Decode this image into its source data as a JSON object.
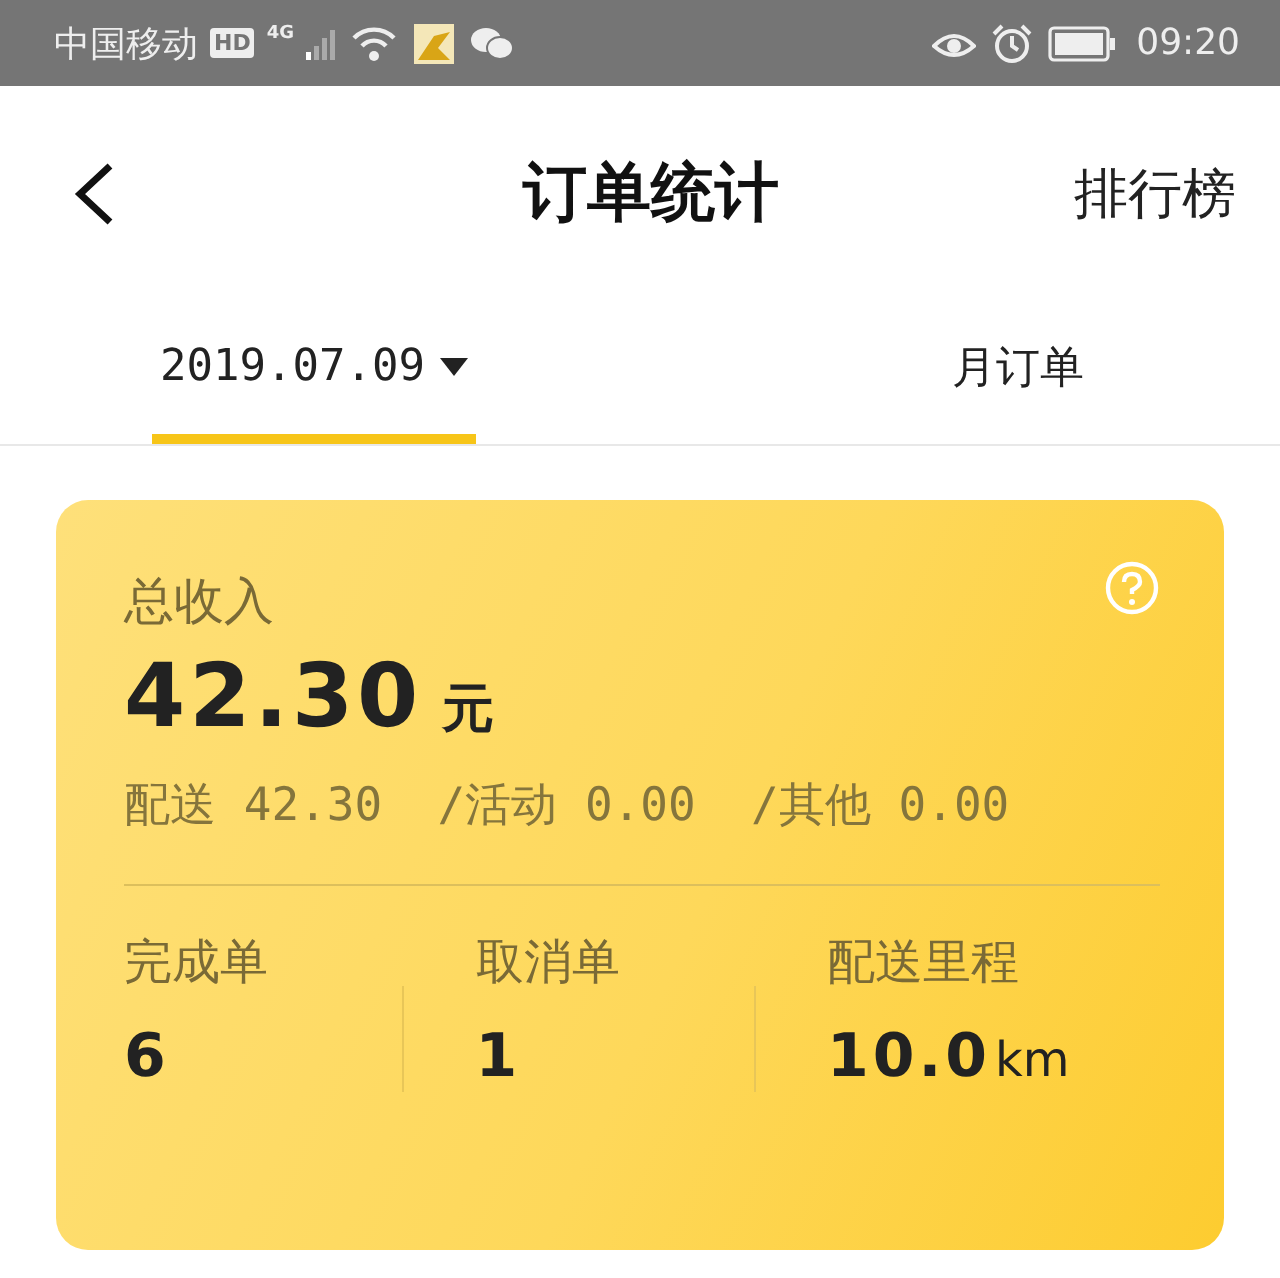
{
  "status_bar": {
    "carrier": "中国移动",
    "hd_badge": "HD",
    "network": "4G",
    "time": "09:20"
  },
  "header": {
    "title": "订单统计",
    "action": "排行榜"
  },
  "tabs": [
    {
      "label": "2019.07.09",
      "kind": "dropdown",
      "selected": true
    },
    {
      "label": "月订单",
      "kind": "plain",
      "selected": false
    }
  ],
  "summary": {
    "label": "总收入",
    "amount": "42.30",
    "currency": "元",
    "breakdown": "配送 42.30  /活动 0.00  /其他 0.00",
    "stats": [
      {
        "label": "完成单",
        "value": "6"
      },
      {
        "label": "取消单",
        "value": "1"
      },
      {
        "label": "配送里程",
        "value": "10.0",
        "unit": "km"
      }
    ]
  }
}
